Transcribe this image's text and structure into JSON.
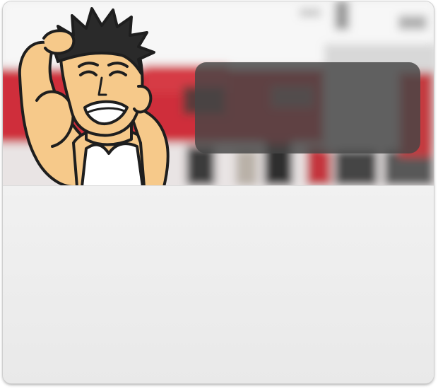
{
  "hero": {
    "mascot_icon": "muscular-man-flexing-cartoon",
    "background": "blurred-gym-photo"
  },
  "overlay": {
    "text": ""
  },
  "colors": {
    "gym_red": "#d4323d",
    "overlay": "#4a4a4a",
    "panel": "#ececec",
    "skin": "#f6c98a",
    "hair": "#2a2a2a"
  }
}
